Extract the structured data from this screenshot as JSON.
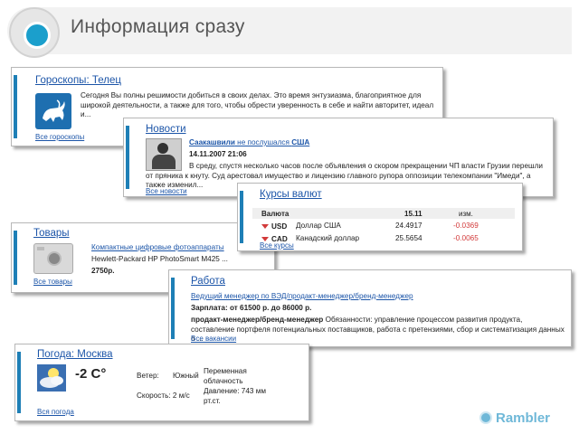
{
  "header": {
    "title": "Информация сразу"
  },
  "horoscope": {
    "title": "Гороскопы: Телец",
    "text": "Сегодня Вы полны решимости добиться в своих делах. Это время энтузиазма, благоприятное для широкой деятельности, а также для того, чтобы обрести уверенность в себе и найти авторитет, идеал и...",
    "all_link": "Все гороскопы",
    "icon": "taurus-icon"
  },
  "news": {
    "title": "Новости",
    "headline_part1": "Саакашвили",
    "headline_part2": " не послушался ",
    "headline_part3": "США",
    "datetime": "14.11.2007 21:06",
    "text": "В среду, спустя несколько часов после объявления о скором прекращении ЧП власти Грузии перешли от пряника к кнуту. Суд арестовал имущество и лицензию главного рупора оппозиции телекомпании \"Имеди\", а также изменил...",
    "all_link": "Все новости"
  },
  "rates": {
    "title": "Курсы валют",
    "headers": {
      "currency": "Валюта",
      "date": "15.11",
      "change": "изм."
    },
    "rows": [
      {
        "code": "USD",
        "name": "Доллар США",
        "value": "24.4917",
        "change": "-0.0369"
      },
      {
        "code": "CAD",
        "name": "Канадский доллар",
        "value": "25.5654",
        "change": "-0.0065"
      }
    ],
    "all_link": "Все курсы"
  },
  "goods": {
    "title": "Товары",
    "category": "Компактные цифровые фотоаппараты",
    "product": "Hewlett-Packard HP PhotoSmart M425 ...",
    "price": "2750р.",
    "all_link": "Все товары"
  },
  "jobs": {
    "title": "Работа",
    "vacancy_line": "Ведущий менеджер по ВЭД/продакт-менеджер/бренд-менеджер",
    "salary": "Зарплата:  от  61500 р. до  86000 р.",
    "desc_bold": "продакт-менеджер/бренд-менеджер",
    "desc_rest": " Обязанности: управление процессом развития продукта, составление портфеля потенциальных поставщиков, работа с претензиями, сбор и систематизация данных о ...",
    "all_link": "Все вакансии"
  },
  "weather": {
    "title": "Погода: Москва",
    "temp": "-2 C°",
    "wind_label": "Ветер:",
    "wind_value": "Южный",
    "speed_label": "Скорость: 2 м/с",
    "condition": "Переменная облачность",
    "pressure": "Давление: 743 мм рт.ст.",
    "all_link": "Вся погода"
  },
  "footer": {
    "brand": "Rambler"
  },
  "colors": {
    "accent": "#1e7fb6",
    "link": "#1c55a8",
    "negative": "#d23a3a"
  }
}
